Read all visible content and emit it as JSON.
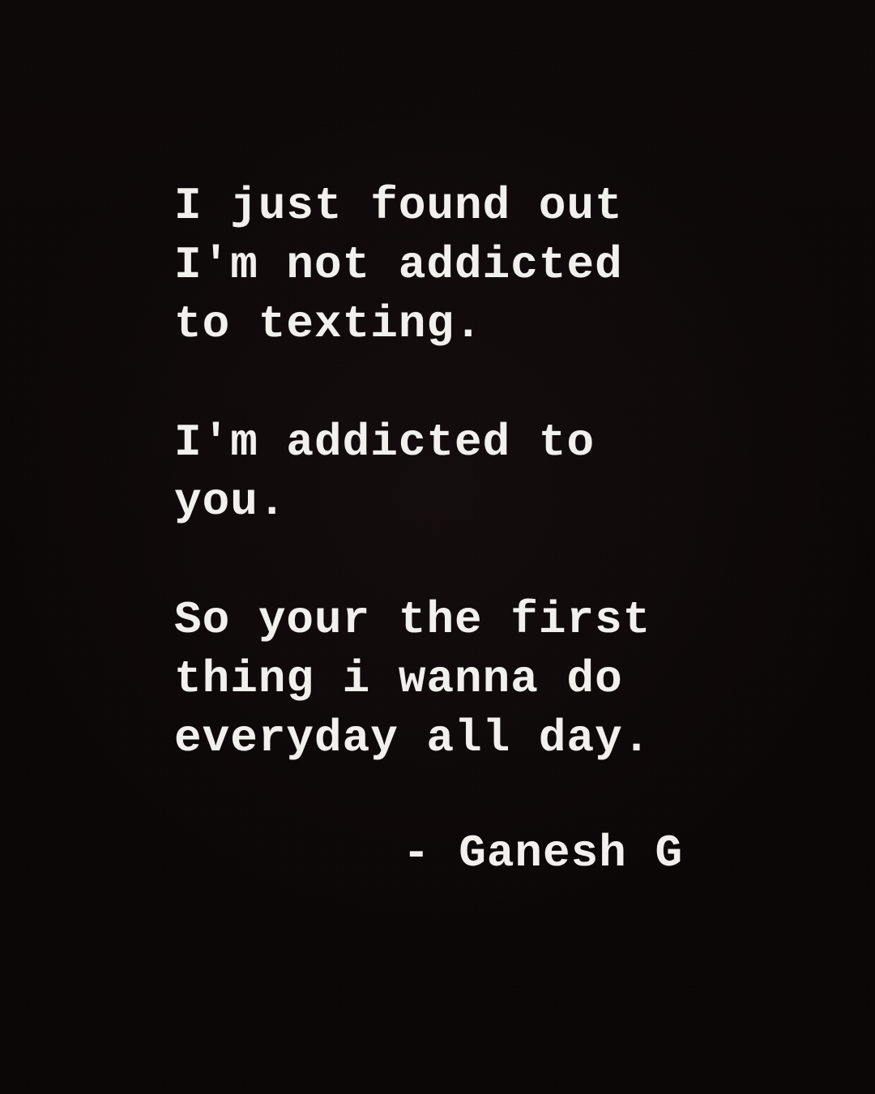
{
  "quote": {
    "stanzas": [
      {
        "lines": [
          "I just found out",
          "I'm not addicted",
          "to texting."
        ]
      },
      {
        "lines": [
          "I'm addicted to",
          "you."
        ]
      },
      {
        "lines": [
          "So your the first",
          "thing i wanna do",
          "everyday all day."
        ]
      }
    ]
  },
  "attribution": {
    "text": "- Ganesh G"
  },
  "colors": {
    "background": "#0c0708",
    "text": "#f2f0ec"
  }
}
